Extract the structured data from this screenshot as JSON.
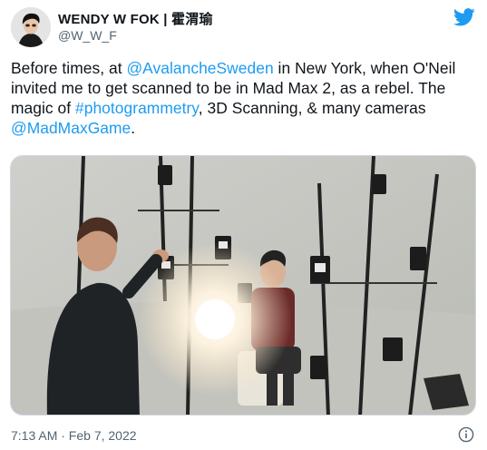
{
  "author": {
    "display_name": "WENDY W FOK | 霍渭瑜",
    "handle": "@W_W_F",
    "avatar_icon": "profile-avatar"
  },
  "brand_icon": "twitter-bird-icon",
  "colors": {
    "link": "#1d9bf0",
    "text": "#0f1419",
    "secondary": "#536471",
    "brand": "#1d9bf0"
  },
  "tweet": {
    "text_1": "Before times, at ",
    "mention_1": "@AvalancheSweden",
    "text_2": " in New York, when O'Neil invited me to get scanned to be in Mad Max 2, as a rebel. The magic of ",
    "hashtag_1": "#photogrammetry",
    "text_3": ", 3D Scanning, & many cameras ",
    "mention_2": "@MadMaxGame",
    "text_4": "."
  },
  "media": {
    "icon": "photo-image"
  },
  "footer": {
    "timestamp": "7:13 AM · Feb 7, 2022",
    "info_icon": "info-icon"
  }
}
